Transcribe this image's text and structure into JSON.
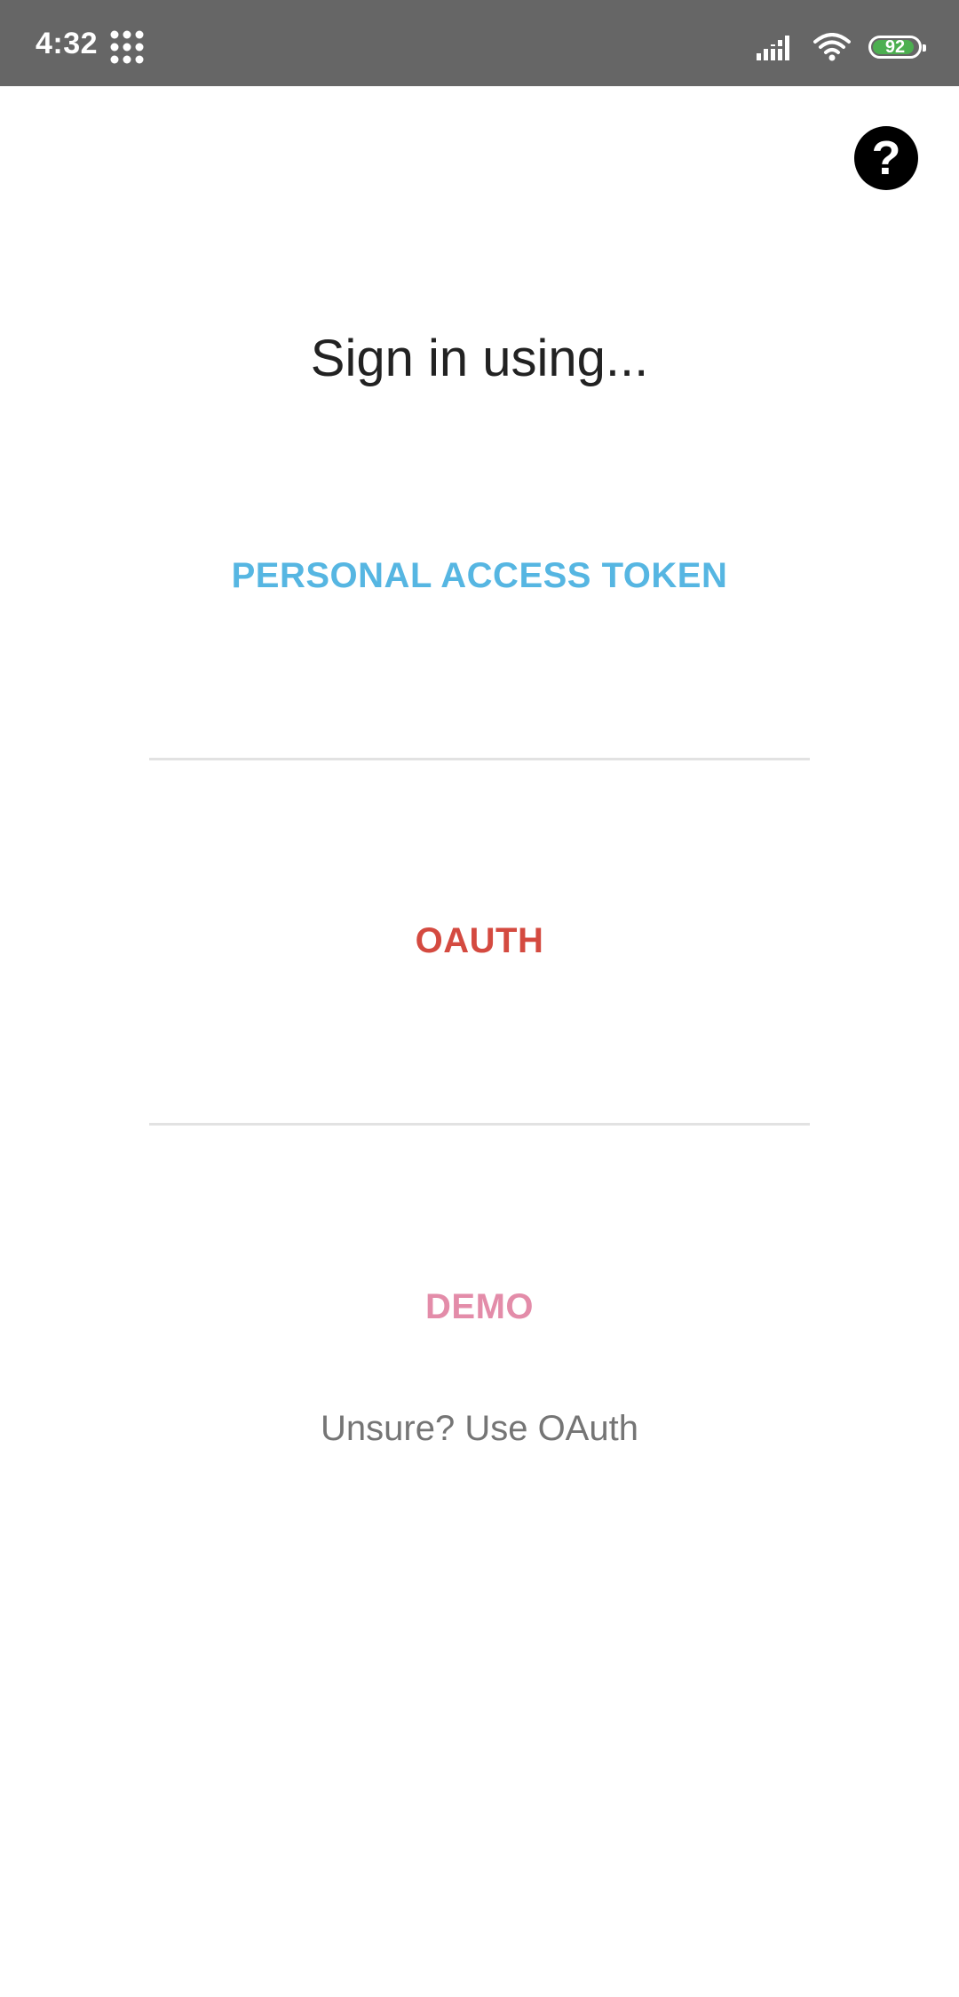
{
  "status_bar": {
    "time": "4:32",
    "grid_icon": "app-grid-icon",
    "signal_icon": "signal-icon",
    "wifi_icon": "wifi-icon",
    "battery_level": "92",
    "battery_color": "#4caf50"
  },
  "header": {
    "help_label": "?",
    "help_icon": "help-icon"
  },
  "main": {
    "title": "Sign in using...",
    "options": [
      {
        "label": "PERSONAL ACCESS TOKEN",
        "color": "#56b6e2"
      },
      {
        "label": "OAUTH",
        "color": "#d44a40"
      },
      {
        "label": "DEMO",
        "color": "#e38ca9"
      }
    ],
    "hint": "Unsure? Use OAuth"
  }
}
